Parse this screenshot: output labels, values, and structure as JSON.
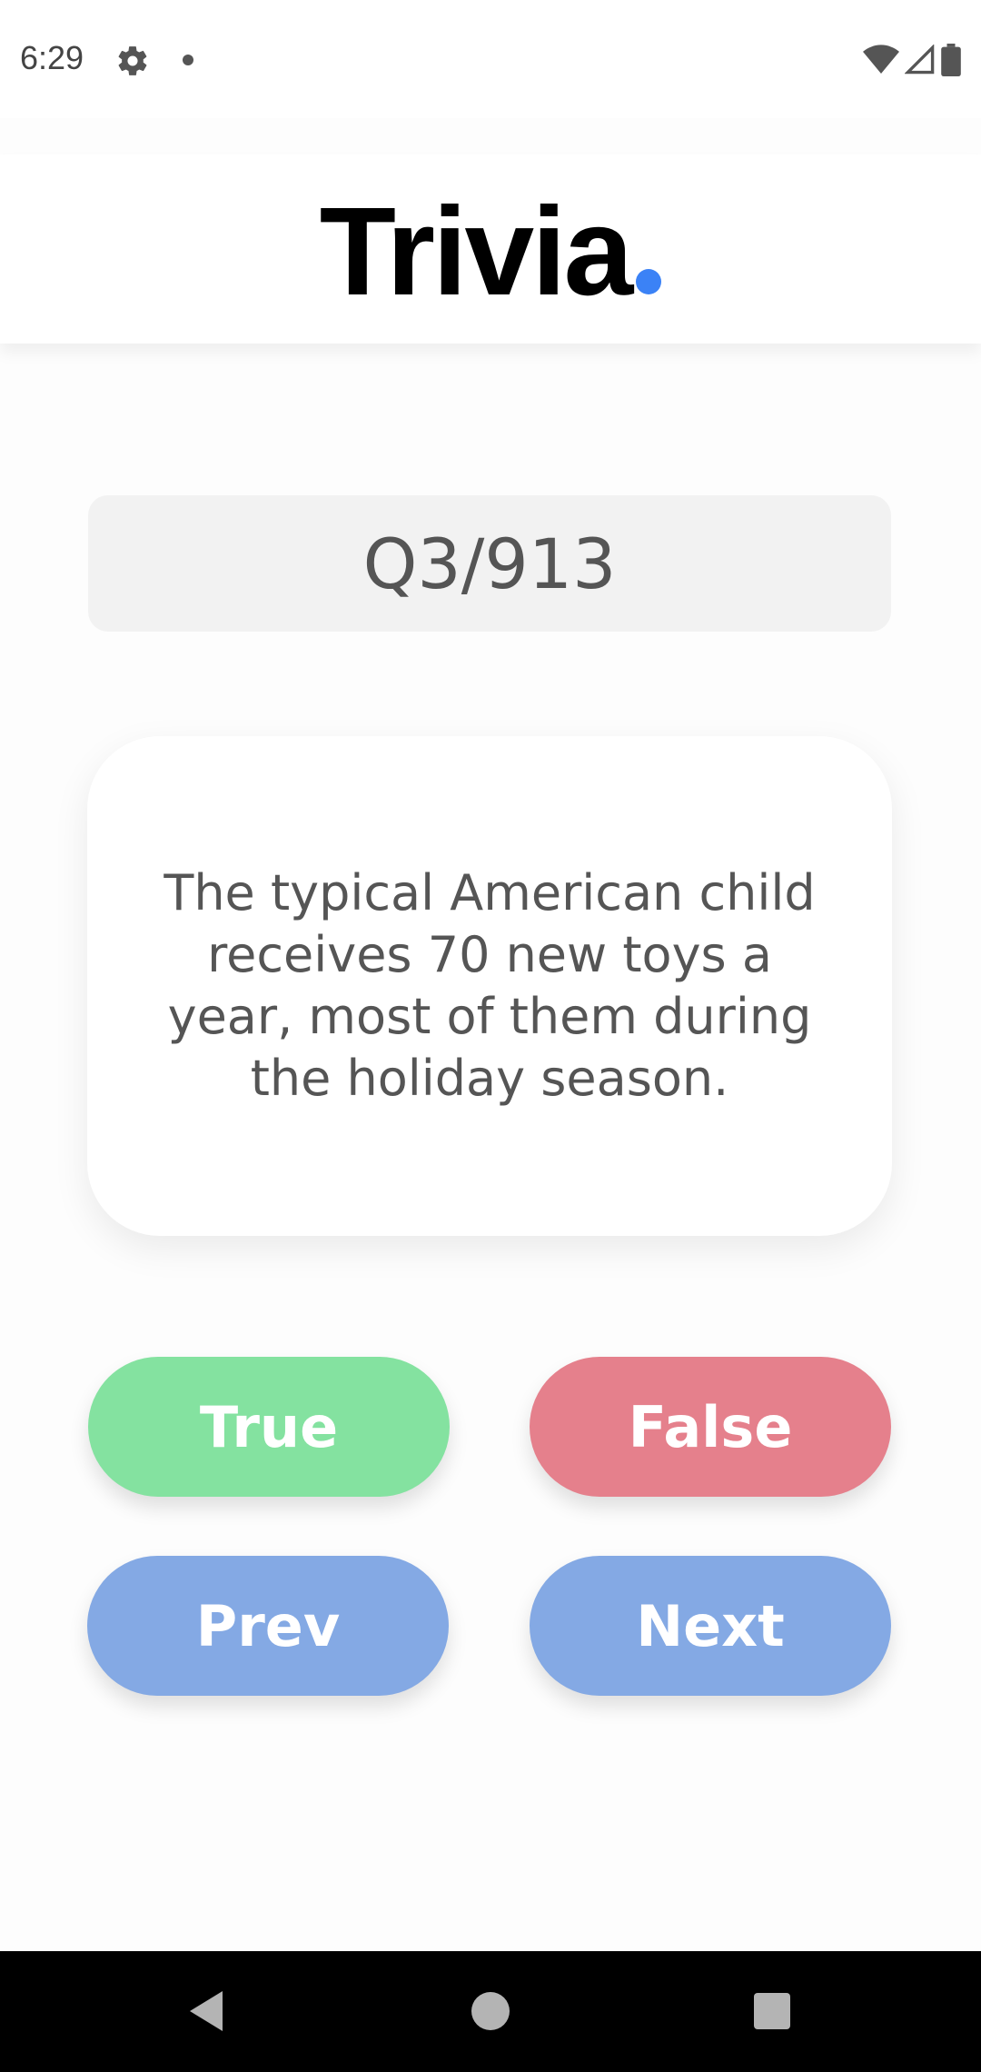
{
  "status_bar": {
    "time": "6:29",
    "icons": [
      "gear-icon",
      "notification-dot-icon",
      "wifi-icon",
      "signal-icon",
      "battery-icon"
    ]
  },
  "header": {
    "brand_text": "Trivia",
    "brand_accent_color": "#3b82f6"
  },
  "counter": {
    "text": "Q3/913"
  },
  "question": {
    "text": "The typical American child receives 70 new toys a year, most of them during the holiday season."
  },
  "buttons": {
    "true_label": "True",
    "false_label": "False",
    "prev_label": "Prev",
    "next_label": "Next",
    "true_color": "#84e2a0",
    "false_color": "#e5808c",
    "nav_color": "#84a9e4"
  },
  "nav_bar": {
    "icons": [
      "back-icon",
      "home-icon",
      "recents-icon"
    ]
  }
}
